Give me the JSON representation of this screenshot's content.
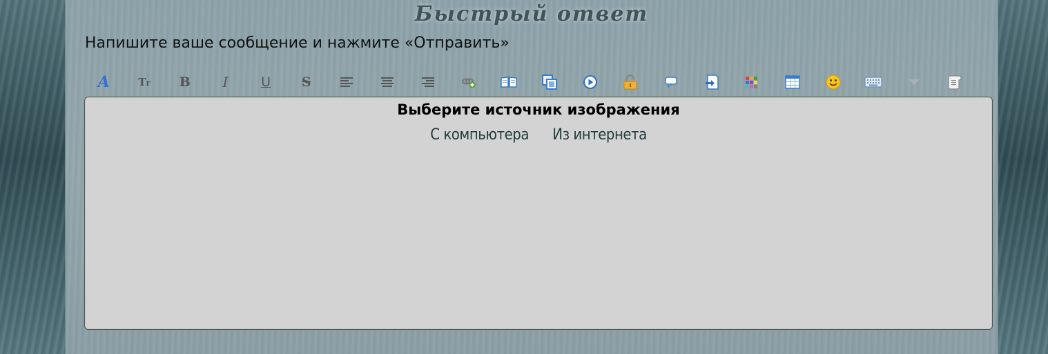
{
  "page": {
    "title": "Быстрый ответ",
    "instruction": "Напишите ваше сообщение и нажмите «Отправить»"
  },
  "toolbar": {
    "buttons": [
      {
        "name": "font-face",
        "icon": "font-face-icon",
        "glyph": "A",
        "color": "#3a6fd0"
      },
      {
        "name": "font-size",
        "icon": "font-size-icon",
        "glyph": "Tт",
        "color": "#555555"
      },
      {
        "name": "bold",
        "icon": "bold-icon",
        "glyph": "B",
        "color": "#555555"
      },
      {
        "name": "italic",
        "icon": "italic-icon",
        "glyph": "I",
        "color": "#555555"
      },
      {
        "name": "underline",
        "icon": "underline-icon",
        "glyph": "U",
        "color": "#555555"
      },
      {
        "name": "strike",
        "icon": "strikethrough-icon",
        "glyph": "S",
        "color": "#555555"
      },
      {
        "name": "align-left",
        "icon": "align-left-icon",
        "glyph": "",
        "color": "#555555"
      },
      {
        "name": "align-center",
        "icon": "align-center-icon",
        "glyph": "",
        "color": "#555555"
      },
      {
        "name": "align-right",
        "icon": "align-right-icon",
        "glyph": "",
        "color": "#555555"
      },
      {
        "name": "link",
        "icon": "link-icon",
        "glyph": "",
        "color": "#6b8e23"
      },
      {
        "name": "quote",
        "icon": "book-icon",
        "glyph": "",
        "color": "#3a7cc8"
      },
      {
        "name": "image",
        "icon": "image-icon",
        "glyph": "",
        "color": "#3a7cc8"
      },
      {
        "name": "video",
        "icon": "play-icon",
        "glyph": "",
        "color": "#2b6fc9"
      },
      {
        "name": "hide",
        "icon": "lock-icon",
        "glyph": "",
        "color": "#e0a020"
      },
      {
        "name": "comment",
        "icon": "speech-bubble-icon",
        "glyph": "",
        "color": "#3a7cc8"
      },
      {
        "name": "spoiler",
        "icon": "document-arrow-icon",
        "glyph": "",
        "color": "#3a7cc8"
      },
      {
        "name": "color",
        "icon": "color-grid-icon",
        "glyph": "",
        "color": "#cc3333"
      },
      {
        "name": "table",
        "icon": "table-icon",
        "glyph": "",
        "color": "#3a7cc8"
      },
      {
        "name": "smiles",
        "icon": "smiley-icon",
        "glyph": "",
        "color": "#f2c020"
      },
      {
        "name": "keyboard",
        "icon": "keyboard-icon",
        "glyph": "",
        "color": "#6a8fb5"
      },
      {
        "name": "more",
        "icon": "chevron-down-icon",
        "glyph": "",
        "color": "#9aa0a6"
      },
      {
        "name": "extra",
        "icon": "scroll-icon",
        "glyph": "",
        "color": "#eeeeee"
      }
    ]
  },
  "upload": {
    "title": "Выберите источник изображения",
    "from_computer": "С компьютера",
    "from_internet": "Из интернета"
  }
}
